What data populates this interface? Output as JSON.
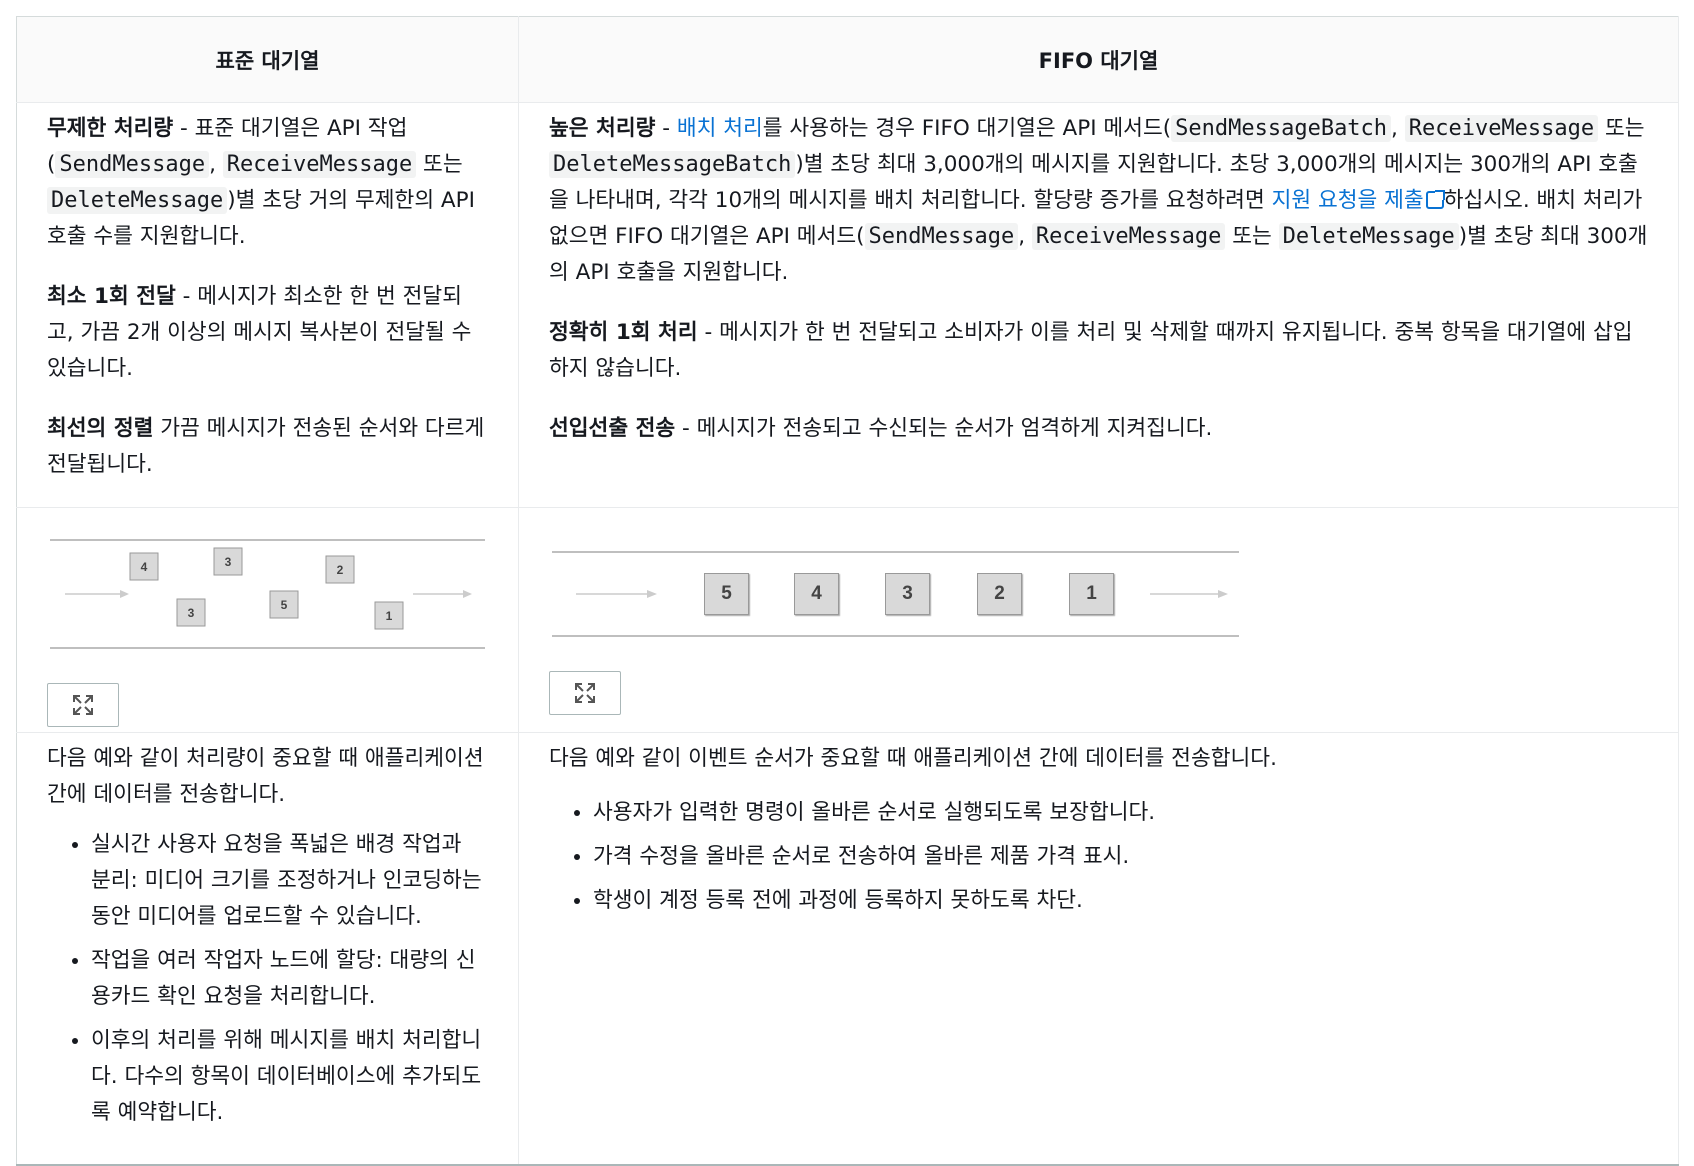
{
  "headers": {
    "standard": "표준 대기열",
    "fifo": "FIFO 대기열"
  },
  "standard": {
    "features": [
      {
        "term": "무제한 처리량",
        "sep": " - ",
        "text1": "표준 대기열은 API 작업 (",
        "code1": "SendMessage",
        "comma1": ", ",
        "code2": "ReceiveMessage",
        "mid": " 또는 ",
        "code3": "DeleteMessage",
        "text2": ")별 초당 거의 무제한의 API 호출 수를 지원합니다."
      },
      {
        "term": "최소 1회 전달",
        "sep": " - ",
        "text": "메시지가 최소한 한 번 전달되고, 가끔 2개 이상의 메시지 복사본이 전달될 수 있습니다."
      },
      {
        "term": "최선의 정렬",
        "sep": " ",
        "text": "가끔 메시지가 전송된 순서와 다르게 전달됩니다."
      }
    ],
    "diagram": {
      "top_row": [
        "4",
        "3",
        "2"
      ],
      "bottom_row": [
        "3",
        "5",
        "1"
      ]
    },
    "usage_intro": "다음 예와 같이 처리량이 중요할 때 애플리케이션 간에 데이터를 전송합니다.",
    "usage_items": [
      "실시간 사용자 요청을 폭넓은 배경 작업과 분리: 미디어 크기를 조정하거나 인코딩하는 동안 미디어를 업로드할 수 있습니다.",
      "작업을 여러 작업자 노드에 할당: 대량의 신용카드 확인 요청을 처리합니다.",
      "이후의 처리를 위해 메시지를 배치 처리합니다. 다수의 항목이 데이터베이스에 추가되도록 예약합니다."
    ]
  },
  "fifo": {
    "features": [
      {
        "term": "높은 처리량",
        "sep": " - ",
        "link1": "배치 처리",
        "text1": "를 사용하는 경우 FIFO 대기열은 API 메서드(",
        "code1": "SendMessageBatch",
        "comma1": ", ",
        "code2": "ReceiveMessage",
        "mid": " 또는 ",
        "code3": "DeleteMessageBatch",
        "text2": ")별 초당 최대 3,000개의 메시지를 지원합니다. 초당 3,000개의 메시지는 300개의 API 호출을 나타내며, 각각 10개의 메시지를 배치 처리합니다. 할당량 증가를 요청하려면 ",
        "link2": "지원 요청을 제출",
        "text3": "하십시오. 배치 처리가 없으면 FIFO 대기열은 API 메서드(",
        "code4": "SendMessage",
        "comma2": ", ",
        "code5": "ReceiveMessage",
        "mid2": " 또는 ",
        "code6": "DeleteMessage",
        "text4": ")별 초당 최대 300개의 API 호출을 지원합니다."
      },
      {
        "term": "정확히 1회 처리",
        "sep": " - ",
        "text": "메시지가 한 번 전달되고 소비자가 이를 처리 및 삭제할 때까지 유지됩니다. 중복 항목을 대기열에 삽입하지 않습니다."
      },
      {
        "term": "선입선출 전송",
        "sep": " - ",
        "text": "메시지가 전송되고 수신되는 순서가 엄격하게 지켜집니다."
      }
    ],
    "diagram": {
      "boxes": [
        "5",
        "4",
        "3",
        "2",
        "1"
      ]
    },
    "usage_intro": "다음 예와 같이 이벤트 순서가 중요할 때 애플리케이션 간에 데이터를 전송합니다.",
    "usage_items": [
      "사용자가 입력한 명령이 올바른 순서로 실행되도록 보장합니다.",
      "가격 수정을 올바른 순서로 전송하여 올바른 제품 가격 표시.",
      "학생이 계정 등록 전에 과정에 등록하지 못하도록 차단."
    ]
  },
  "icons": {
    "expand": "expand-icon",
    "external_link": "external-link-icon"
  }
}
